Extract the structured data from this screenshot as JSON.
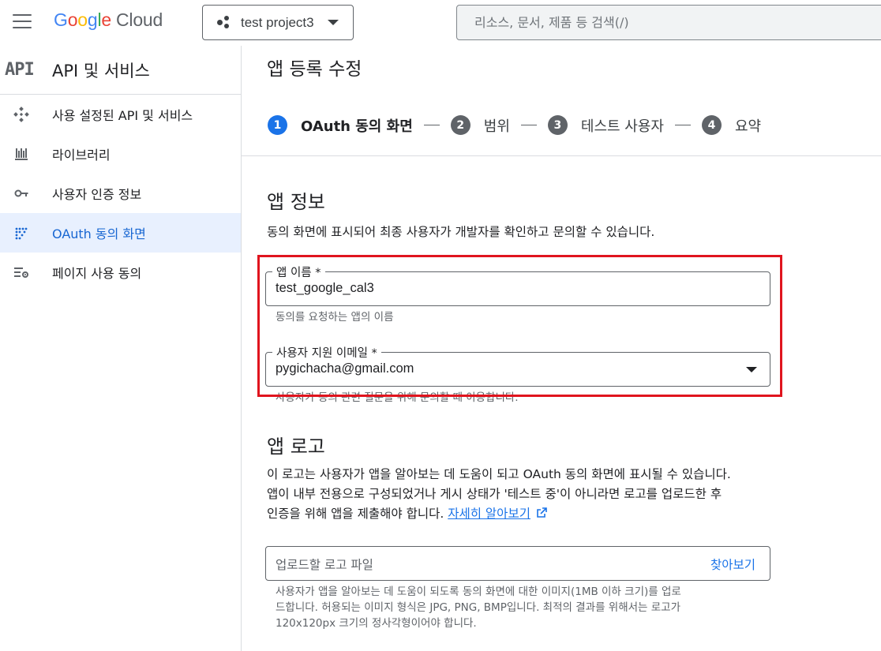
{
  "topbar": {
    "logo_google": [
      "G",
      "o",
      "o",
      "g",
      "l",
      "e"
    ],
    "logo_cloud": "Cloud",
    "project_name": "test project3",
    "search_placeholder": "리소스, 문서, 제품 등 검색(/)"
  },
  "sidebar": {
    "api_logo": "API",
    "title": "API 및 서비스",
    "items": [
      {
        "label": "사용 설정된 API 및 서비스",
        "icon": "diamond-arrows-icon",
        "active": false
      },
      {
        "label": "라이브러리",
        "icon": "library-icon",
        "active": false
      },
      {
        "label": "사용자 인증 정보",
        "icon": "key-icon",
        "active": false
      },
      {
        "label": "OAuth 동의 화면",
        "icon": "oauth-dots-icon",
        "active": true
      },
      {
        "label": "페이지 사용 동의",
        "icon": "list-settings-icon",
        "active": false
      }
    ]
  },
  "main": {
    "page_title": "앱 등록 수정",
    "steps": [
      {
        "num": "1",
        "label": "OAuth 동의 화면",
        "active": true
      },
      {
        "num": "2",
        "label": "범위",
        "active": false
      },
      {
        "num": "3",
        "label": "테스트 사용자",
        "active": false
      },
      {
        "num": "4",
        "label": "요약",
        "active": false
      }
    ],
    "app_info": {
      "title": "앱 정보",
      "desc": "동의 화면에 표시되어 최종 사용자가 개발자를 확인하고 문의할 수 있습니다.",
      "app_name_label": "앱 이름 *",
      "app_name_value": "test_google_cal3",
      "app_name_helper": "동의를 요청하는 앱의 이름",
      "email_label": "사용자 지원 이메일 *",
      "email_value": "pygichacha@gmail.com",
      "email_helper": "사용자가 동의 관련 질문을 위해 문의할 때 이용합니다."
    },
    "app_logo": {
      "title": "앱 로고",
      "desc_line1": "이 로고는 사용자가 앱을 알아보는 데 도움이 되고 OAuth 동의 화면에 표시될 수 있습니다.",
      "desc_line2": "앱이 내부 전용으로 구성되었거나 게시 상태가 '테스트 중'이 아니라면 로고를 업로드한 후",
      "desc_line3": "인증을 위해 앱을 제출해야 합니다.",
      "learn_more": "자세히 알아보기",
      "upload_placeholder": "업로드할 로고 파일",
      "browse_label": "찾아보기",
      "helper_line1": "사용자가 앱을 알아보는 데 도움이 되도록 동의 화면에 대한 이미지(1MB 이하 크기)를 업로",
      "helper_line2": "드합니다. 허용되는 이미지 형식은 JPG, PNG, BMP입니다. 최적의 결과를 위해서는 로고가",
      "helper_line3": "120x120px 크기의 정사각형이어야 합니다."
    }
  },
  "colors": {
    "accent": "#1a73e8",
    "active_bg": "#e8f0fe",
    "highlight": "#e0141e"
  }
}
